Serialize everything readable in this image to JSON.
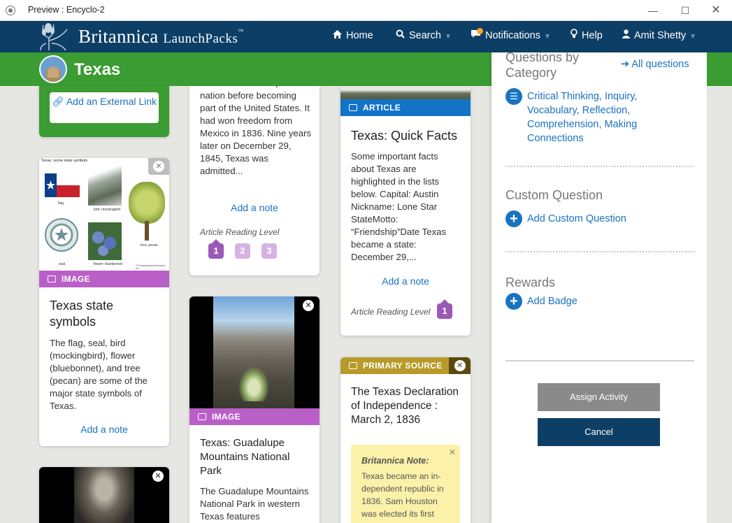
{
  "window": {
    "title": "Preview : Encyclo-2",
    "controls": {
      "minimize": "—",
      "maximize": "☐",
      "close": "✕"
    }
  },
  "brand": {
    "name": "Britannica",
    "product": "LaunchPacks",
    "trademark": "™"
  },
  "nav": {
    "home": "Home",
    "search": "Search",
    "notifications": "Notifications",
    "help": "Help",
    "user": "Amit Shetty"
  },
  "page": {
    "title": "Texas"
  },
  "cards": {
    "external_link": {
      "label": "Add an External Link"
    },
    "state_symbols": {
      "type_label": "IMAGE",
      "title": "Texas state symbols",
      "body": "The flag, seal, bird (mockingbird), flower (bluebonnet), and tree (pecan) are some of the major state symbols of Texas.",
      "add_note": "Add a note",
      "thumb": {
        "heading": "Texas: some state symbols",
        "flag": "flag",
        "bird": "bird: mockingbird",
        "seal": "seal",
        "flower": "flower: bluebonnet",
        "tree": "tree: pecan",
        "credit": "© Encyclopædia Britannica, Inc."
      }
    },
    "independent": {
      "body": "Texas was an independent nation before becoming part of the United States. It had won freedom from Mexico in 1836. Nine years later on December 29, 1845, Texas was admitted...",
      "add_note": "Add a note",
      "reading_level_label": "Article Reading Level",
      "levels": [
        "1",
        "2",
        "3"
      ]
    },
    "quick_facts": {
      "type_label": "ARTICLE",
      "title": "Texas: Quick Facts",
      "body": "Some important facts about Texas are highlighted in the lists below. Capital: Austin Nickname: Lone Star StateMotto: “Friendship”Date Texas became a state: December 29,...",
      "add_note": "Add a note",
      "reading_level_label": "Article Reading Level",
      "level": "1"
    },
    "guadalupe": {
      "type_label": "IMAGE",
      "title": "Texas: Guadalupe Mountains National Park",
      "body": "The Guadalupe Mountains National Park in western Texas features"
    },
    "declaration": {
      "type_label": "PRIMARY SOURCE",
      "title": "The Texas Declaration of Independence : March 2, 1836",
      "note_title": "Britannica Note:",
      "note_body": "Texas became an in-dependent republic in 1836. Sam Houston was elected its first"
    }
  },
  "panel": {
    "questions_heading": "Questions by Category",
    "all_questions": "All questions",
    "categories": [
      "Critical Thinking",
      "Inquiry",
      "Vocabulary",
      "Reflection",
      "Comprehension",
      "Making Connections"
    ],
    "custom_heading": "Custom Question",
    "add_custom": "Add Custom Question",
    "rewards_heading": "Rewards",
    "add_badge": "Add Badge",
    "assign": "Assign Activity",
    "cancel": "Cancel"
  },
  "colors": {
    "nav_bg": "#0d3f66",
    "green": "#3a9c32",
    "link": "#1a73c0",
    "image_tag": "#b95fc7",
    "article_tag": "#1273c7",
    "primary_tag": "#b89a2a",
    "level": "#9b59b6",
    "note_bg": "#fbf1a9"
  }
}
